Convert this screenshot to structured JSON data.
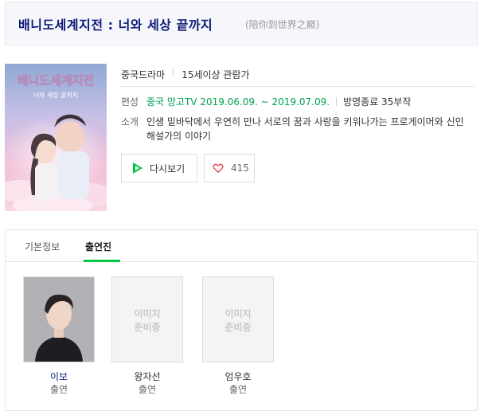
{
  "header": {
    "title": "배니도세계지전 : 너와 세상 끝까지",
    "original_title": "(陪你到世界之巅)"
  },
  "poster": {
    "title_text": "배니도세계지전",
    "subtitle_text": "너와 세상 끝까지"
  },
  "meta": {
    "genre": "중국드라마",
    "rating": "15세이상 관람가"
  },
  "info": {
    "schedule_label": "편성",
    "channel": "중국 망고TV",
    "period": "2019.06.09. ~ 2019.07.09.",
    "status": "방영종료 35부작",
    "intro_label": "소개",
    "intro_text": "인생 밑바닥에서 우연히 만나 서로의 꿈과 사랑을 키워나가는 프로게이머와 신인 해설가의 이야기"
  },
  "actions": {
    "replay_label": "다시보기",
    "like_count": "415",
    "accent_color": "#00c73c",
    "heart_color": "#e5404c"
  },
  "tabs": [
    {
      "label": "기본정보",
      "active": false
    },
    {
      "label": "출연진",
      "active": true
    }
  ],
  "cast": [
    {
      "name": "이보",
      "role": "출연",
      "has_photo": true
    },
    {
      "name": "왕자선",
      "role": "출연",
      "has_photo": false,
      "placeholder": "이미지 준비중"
    },
    {
      "name": "엄우호",
      "role": "출연",
      "has_photo": false,
      "placeholder": "이미지 준비중"
    }
  ]
}
